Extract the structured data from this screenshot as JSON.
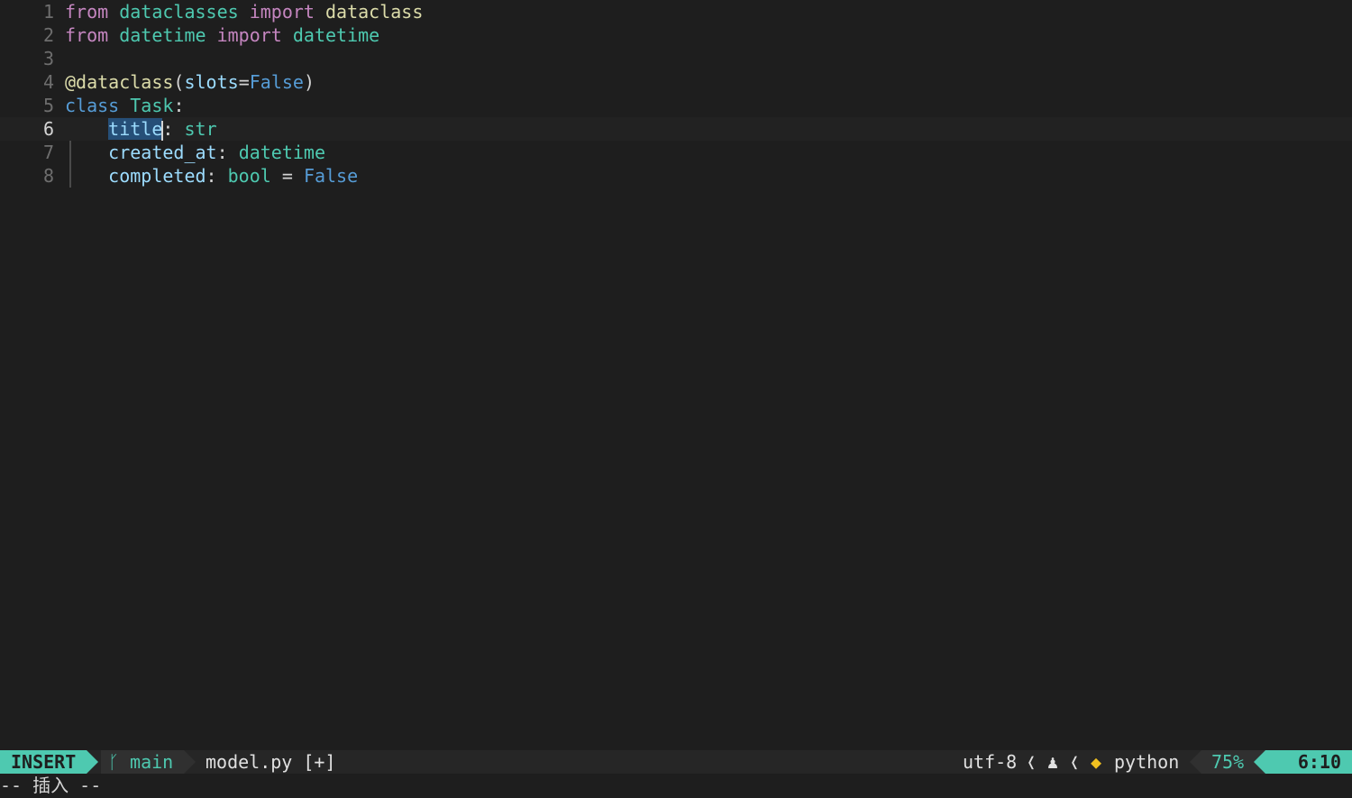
{
  "editor": {
    "line_numbers": [
      "1",
      "2",
      "3",
      "4",
      "5",
      "6",
      "7",
      "8"
    ],
    "lines": [
      {
        "tokens": [
          [
            "kw",
            "from"
          ],
          [
            "sp",
            " "
          ],
          [
            "mod",
            "dataclasses"
          ],
          [
            "sp",
            " "
          ],
          [
            "kw",
            "import"
          ],
          [
            "sp",
            " "
          ],
          [
            "func",
            "dataclass"
          ]
        ]
      },
      {
        "tokens": [
          [
            "kw",
            "from"
          ],
          [
            "sp",
            " "
          ],
          [
            "mod",
            "datetime"
          ],
          [
            "sp",
            " "
          ],
          [
            "kw",
            "import"
          ],
          [
            "sp",
            " "
          ],
          [
            "mod",
            "datetime"
          ]
        ]
      },
      {
        "tokens": []
      },
      {
        "tokens": [
          [
            "func",
            "@dataclass"
          ],
          [
            "punc",
            "("
          ],
          [
            "param",
            "slots"
          ],
          [
            "punc",
            "="
          ],
          [
            "const",
            "False"
          ],
          [
            "punc",
            ")"
          ]
        ]
      },
      {
        "tokens": [
          [
            "key",
            "class"
          ],
          [
            "sp",
            " "
          ],
          [
            "cls",
            "Task"
          ],
          [
            "punc",
            ":"
          ]
        ]
      },
      {
        "tokens": [
          [
            "sp",
            "    "
          ],
          [
            "sel",
            "title"
          ],
          [
            "cursor",
            ""
          ],
          [
            "punc",
            ": "
          ],
          [
            "cls",
            "str"
          ]
        ]
      },
      {
        "tokens": [
          [
            "sp",
            "    "
          ],
          [
            "attr",
            "created_at"
          ],
          [
            "punc",
            ": "
          ],
          [
            "cls",
            "datetime"
          ]
        ]
      },
      {
        "tokens": [
          [
            "sp",
            "    "
          ],
          [
            "attr",
            "completed"
          ],
          [
            "punc",
            ": "
          ],
          [
            "cls",
            "bool"
          ],
          [
            "punc",
            " = "
          ],
          [
            "const",
            "False"
          ]
        ]
      }
    ]
  },
  "statusline": {
    "mode": "INSERT",
    "branch_icon": "ᚴ",
    "branch": "main",
    "filename": "model.py [+]",
    "encoding": "utf-8",
    "separator": "❬",
    "os_icon": "♟",
    "filetype_icon": "◆",
    "filetype": "python",
    "percent": "75%",
    "position": "6:10"
  },
  "cmdline": {
    "text": "-- 插入 --"
  },
  "colors": {
    "accent": "#4ec9b0",
    "background": "#1e1e1e"
  }
}
